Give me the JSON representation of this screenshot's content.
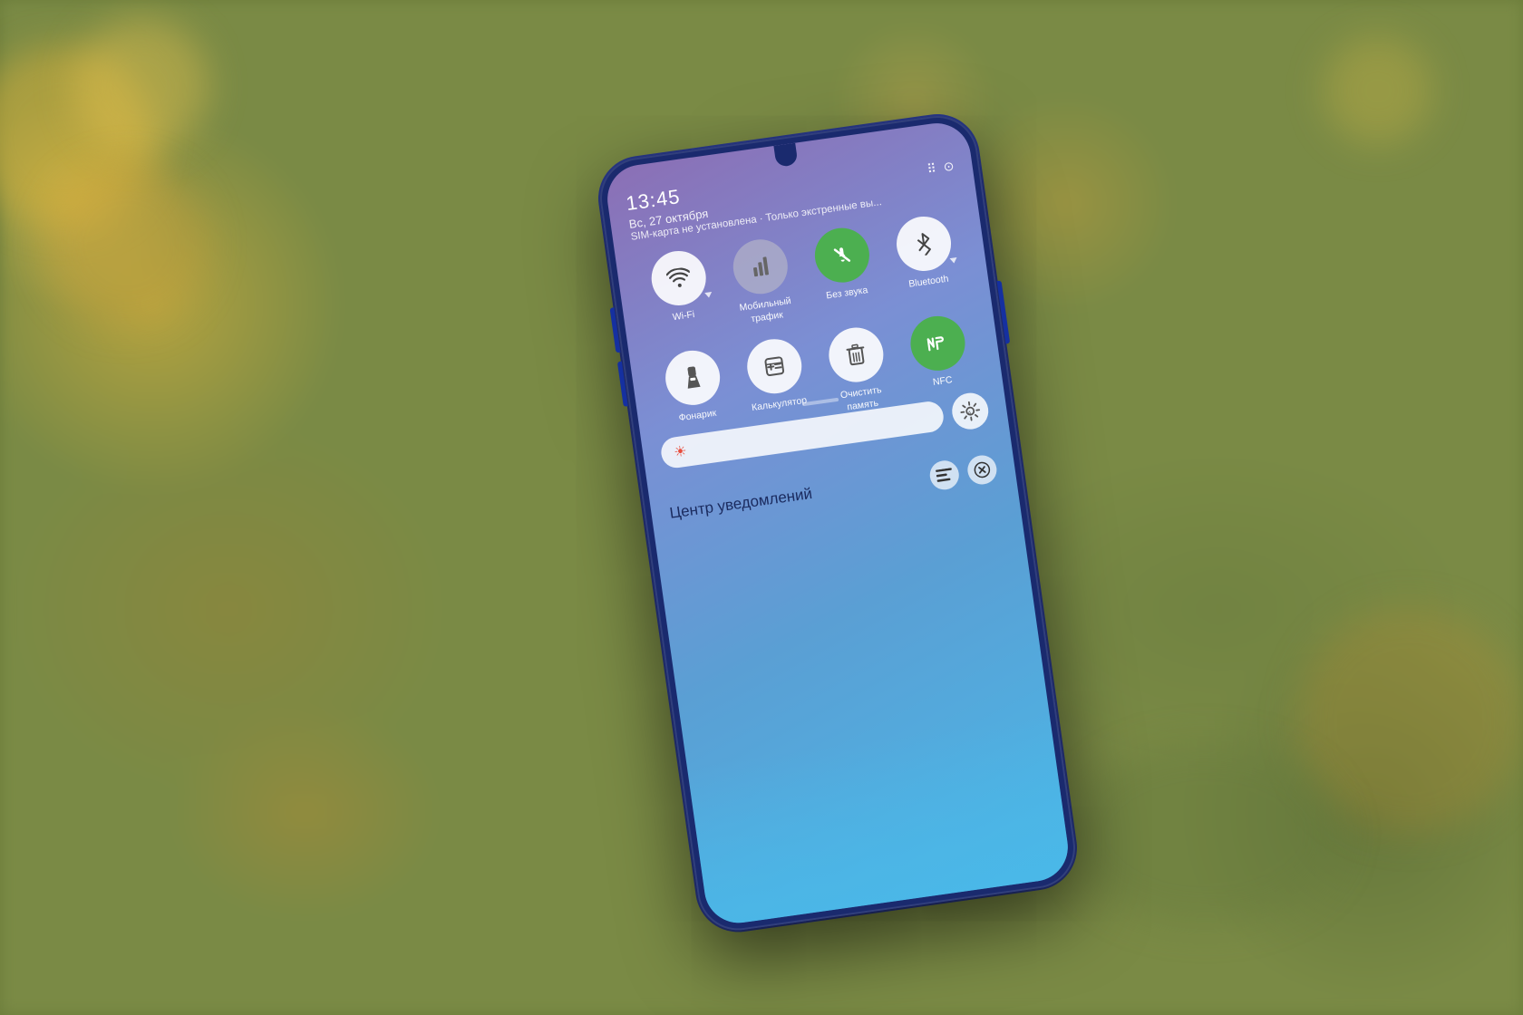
{
  "background": {
    "color": "#7a8a45"
  },
  "phone": {
    "body_color": "#1a2a6e"
  },
  "screen": {
    "time": "13:45",
    "date": "Вс, 27 октября",
    "sim_text": "SIM-карта не установлена · Только экстренные вы...",
    "gradient_start": "#8b6fb5",
    "gradient_end": "#4ab8e8"
  },
  "quick_settings": {
    "row1": [
      {
        "id": "wifi",
        "label": "Wi-Fi",
        "icon": "wifi",
        "active": false,
        "has_arrow": true
      },
      {
        "id": "mobile-data",
        "label": "Мобильный\nтрафик",
        "icon": "mobile",
        "active": false,
        "has_arrow": false
      },
      {
        "id": "no-sound",
        "label": "Без звука",
        "icon": "bell-off",
        "active": true,
        "has_arrow": false
      },
      {
        "id": "bluetooth",
        "label": "Bluetooth",
        "icon": "bluetooth",
        "active": false,
        "has_arrow": true
      }
    ],
    "row2": [
      {
        "id": "flashlight",
        "label": "Фонарик",
        "icon": "flashlight",
        "active": false,
        "has_arrow": false
      },
      {
        "id": "calculator",
        "label": "Калькулятор",
        "icon": "calculator",
        "active": false,
        "has_arrow": false
      },
      {
        "id": "clear-memory",
        "label": "Очистить\nпамять",
        "icon": "trash",
        "active": false,
        "has_arrow": false
      },
      {
        "id": "nfc",
        "label": "NFC",
        "icon": "nfc",
        "active": true,
        "has_arrow": false
      }
    ]
  },
  "brightness": {
    "level": 30,
    "sun_icon": "☀",
    "sun_auto_icon": "☀"
  },
  "notification_center": {
    "title": "Центр уведомлений",
    "list_icon": "≡",
    "close_icon": "⊗"
  }
}
